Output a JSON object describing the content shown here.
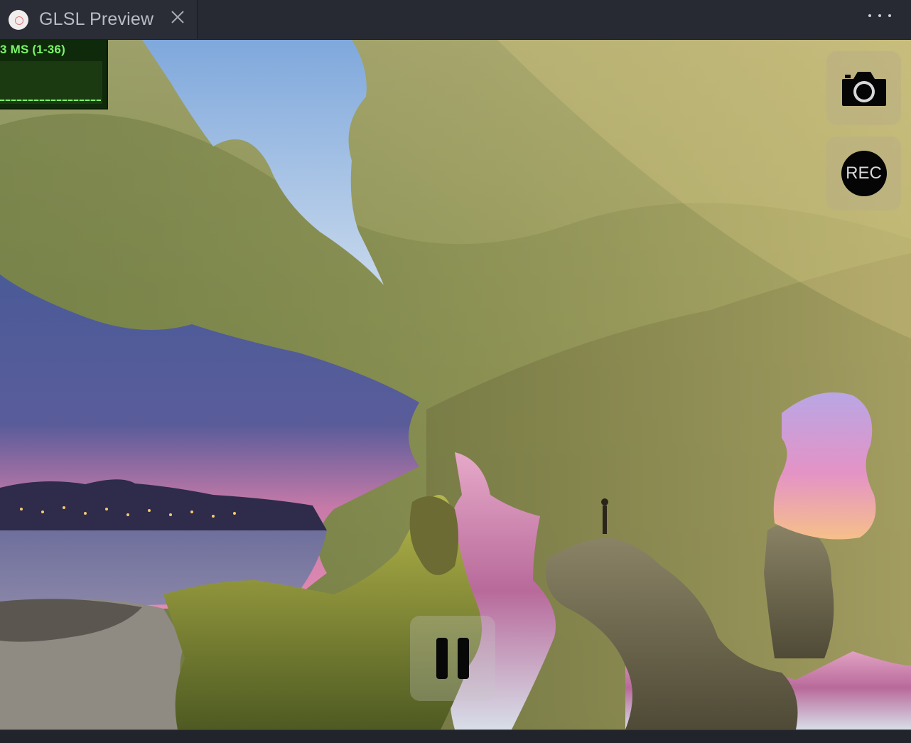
{
  "tab": {
    "title": "GLSL Preview",
    "logo_icon": "glsl-logo-icon",
    "close_icon": "close-icon"
  },
  "toolbar": {
    "more_icon": "more-horizontal-icon"
  },
  "stats": {
    "label": "3 MS (1-36)"
  },
  "controls": {
    "screenshot_icon": "camera-icon",
    "record_label": "REC",
    "pause_icon": "pause-icon"
  },
  "colors": {
    "tabbar_bg": "#272a33",
    "stats_text": "#7cf36a",
    "stats_bg": "#0e2a0a"
  }
}
